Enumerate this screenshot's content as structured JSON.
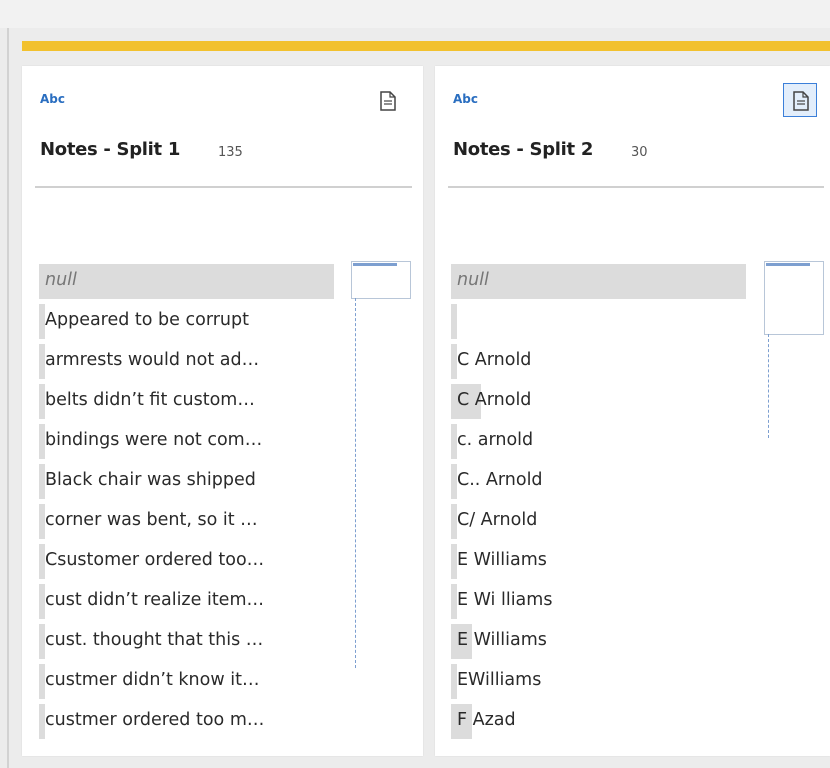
{
  "panels": [
    {
      "type_label": "Abc",
      "title": "Notes - Split 1",
      "count": "135",
      "values": [
        {
          "text": "null",
          "bar": 1.0,
          "is_null": true
        },
        {
          "text": "Appeared to be corrupt",
          "bar": 0.02
        },
        {
          "text": "armrests would not ad…",
          "bar": 0.02
        },
        {
          "text": "belts didn’t fit custom…",
          "bar": 0.02
        },
        {
          "text": "bindings were not com…",
          "bar": 0.02
        },
        {
          "text": "Black chair was shipped",
          "bar": 0.02
        },
        {
          "text": "corner was bent, so it …",
          "bar": 0.02
        },
        {
          "text": "Csustomer ordered too…",
          "bar": 0.02
        },
        {
          "text": "cust didn’t realize item…",
          "bar": 0.02
        },
        {
          "text": "cust. thought that this …",
          "bar": 0.02
        },
        {
          "text": "custmer didn’t know it…",
          "bar": 0.02
        },
        {
          "text": "custmer ordered too m…",
          "bar": 0.02
        }
      ]
    },
    {
      "type_label": "Abc",
      "title": "Notes - Split 2",
      "count": "30",
      "values": [
        {
          "text": "null",
          "bar": 1.0,
          "is_null": true
        },
        {
          "text": "",
          "bar": 0.02
        },
        {
          "text": "C  Arnold",
          "bar": 0.02
        },
        {
          "text": "C Arnold",
          "bar": 0.1
        },
        {
          "text": "c. arnold",
          "bar": 0.02
        },
        {
          "text": "C.. Arnold",
          "bar": 0.02
        },
        {
          "text": "C/ Arnold",
          "bar": 0.02
        },
        {
          "text": "E   Williams",
          "bar": 0.02
        },
        {
          "text": "E Wi lliams",
          "bar": 0.02
        },
        {
          "text": "E Williams",
          "bar": 0.07
        },
        {
          "text": "EWilliams",
          "bar": 0.02
        },
        {
          "text": "F Azad",
          "bar": 0.07
        }
      ]
    }
  ],
  "colors": {
    "accent_bar": "#f2c12e",
    "type_label": "#2a6ec0",
    "value_bar": "#dcdcdc"
  },
  "icons": {
    "column_detail": "document-list-icon"
  }
}
